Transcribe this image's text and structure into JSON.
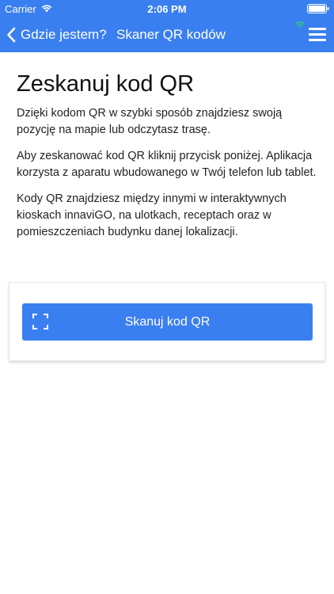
{
  "status_bar": {
    "carrier": "Carrier",
    "time": "2:06 PM",
    "wifi_icon": "wifi-icon",
    "battery_icon": "battery-icon"
  },
  "nav": {
    "back_label": "Gdzie jestem?",
    "title": "Skaner QR kodów",
    "menu_icon": "hamburger-menu-icon",
    "signal_icon": "signal-icon"
  },
  "main": {
    "title": "Zeskanuj kod QR",
    "paragraphs": [
      "Dzięki kodom QR w szybki sposób znajdziesz swoją pozycję na mapie lub odczytasz trasę.",
      "Aby zeskanować kod QR kliknij przycisk poniżej. Aplikacja korzysta z aparatu wbudowanego w Twój telefon lub tablet.",
      "Kody QR znajdziesz między innymi w interaktywnych kioskach innaviGO, na ulotkach, receptach oraz w pomieszczeniach budynku danej lokalizacji."
    ],
    "scan_button_label": "Skanuj kod QR",
    "scan_icon": "scan-frame-icon"
  },
  "colors": {
    "accent": "#3a7ff0",
    "signal": "#2ecc71",
    "text": "#222222",
    "background": "#ffffff"
  }
}
